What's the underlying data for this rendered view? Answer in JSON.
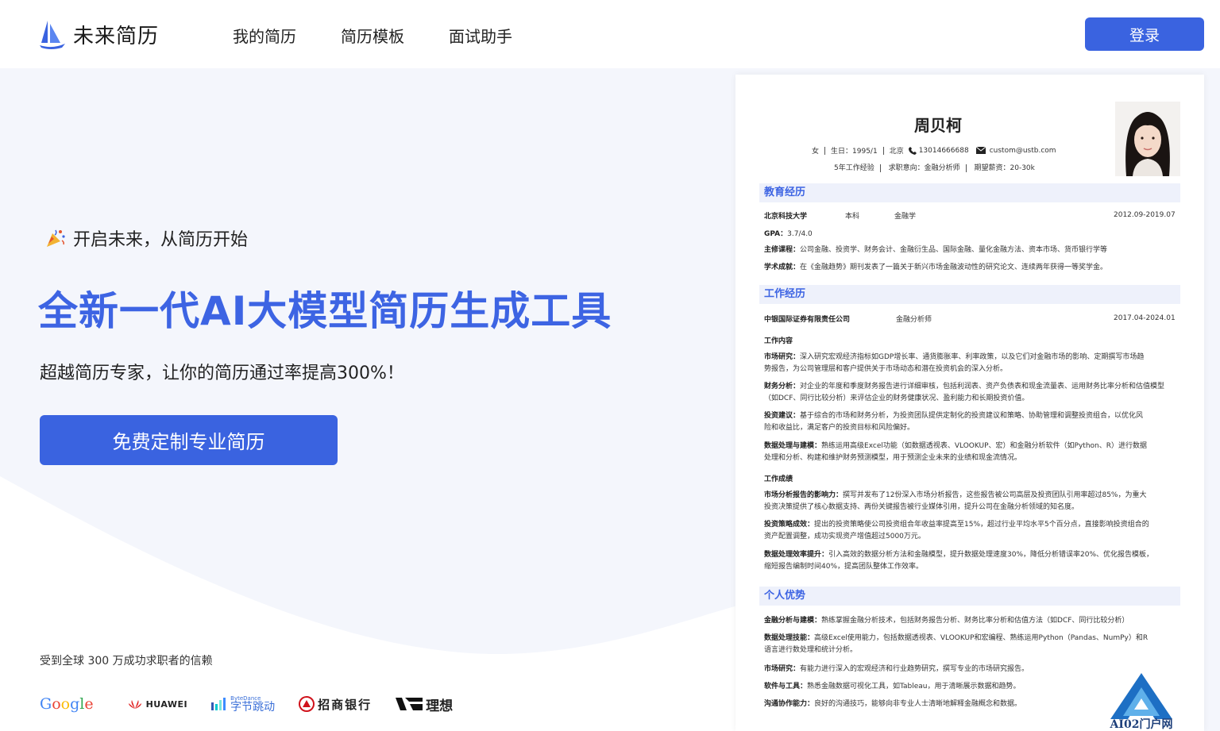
{
  "header": {
    "logo_text": "未来简历",
    "nav": [
      "我的简历",
      "简历模板",
      "面试助手"
    ],
    "login_label": "登录"
  },
  "hero": {
    "tagline": "开启未来，从简历开始",
    "headline": "全新一代AI大模型简历生成工具",
    "subhead": "超越简历专家，让你的简历通过率提高300%！",
    "cta_label": "免费定制专业简历",
    "trust_text": "受到全球 300 万成功求职者的信赖"
  },
  "partners": {
    "google": [
      "G",
      "o",
      "o",
      "g",
      "l",
      "e"
    ],
    "huawei": "HUAWEI",
    "bytedance_en": "ByteDance",
    "bytedance_cn": "字节跳动",
    "cmb": "招商银行",
    "lixiang": "理想"
  },
  "resume": {
    "name": "周贝柯",
    "gender": "女",
    "birth": "生日：1995/1",
    "city": "北京",
    "phone": "13014666688",
    "email": "custom@ustb.com",
    "experience_years": "5年工作经验",
    "target_job": "求职意向：金融分析师",
    "salary": "期望薪资：20-30k",
    "sections": {
      "education": "教育经历",
      "work": "工作经历",
      "strengths": "个人优势"
    },
    "education": {
      "school": "北京科技大学",
      "degree": "本科",
      "major": "金融学",
      "period": "2012.09-2019.07",
      "gpa_label": "GPA：",
      "gpa": "3.7/4.0",
      "courses_label": "主修课程：",
      "courses": "公司金融、投资学、财务会计、金融衍生品、国际金融、量化金融方法、资本市场、货币银行学等",
      "achievements_label": "学术成就：",
      "achievements": "在《金融趋势》期刊发表了一篇关于新兴市场金融波动性的研究论文、连续两年获得一等奖学金。"
    },
    "work": {
      "company": "中银国际证券有限责任公司",
      "title": "金融分析师",
      "period": "2017.04-2024.01",
      "content_label": "工作内容",
      "items": [
        {
          "label": "市场研究：",
          "text": "深入研究宏观经济指标如GDP增长率、通货膨胀率、利率政策，以及它们对金融市场的影响、定期撰写市场趋",
          "text2": "势报告，为公司管理层和客户提供关于市场动态和潜在投资机会的深入分析。"
        },
        {
          "label": "财务分析：",
          "text": "对企业的年度和季度财务报告进行详细审核，包括利润表、资产负债表和现金流量表、运用财务比率分析和估值模型",
          "text2": "（如DCF、同行比较分析）来评估企业的财务健康状况、盈利能力和长期投资价值。"
        },
        {
          "label": "投资建议：",
          "text": "基于综合的市场和财务分析，为投资团队提供定制化的投资建议和策略、协助管理和调整投资组合，以优化风",
          "text2": "险和收益比，满足客户的投资目标和风险偏好。"
        },
        {
          "label": "数据处理与建模：",
          "text": "熟练运用高级Excel功能（如数据透视表、VLOOKUP、宏）和金融分析软件（如Python、R）进行数据",
          "text2": "处理和分析、构建和维护财务预测模型，用于预测企业未来的业绩和现金流情况。"
        }
      ],
      "results_label": "工作成绩",
      "results": [
        {
          "label": "市场分析报告的影响力：",
          "text": "撰写并发布了12份深入市场分析报告，这些报告被公司高层及投资团队引用率超过85%，为重大",
          "text2": "投资决策提供了核心数据支持、两份关键报告被行业媒体引用，提升公司在金融分析领域的知名度。"
        },
        {
          "label": "投资策略成效：",
          "text": "提出的投资策略使公司投资组合年收益率提高至15%，超过行业平均水平5个百分点，直接影响投资组合的",
          "text2": "资产配置调整，成功实现资产增值超过5000万元。"
        },
        {
          "label": "数据处理效率提升：",
          "text": "引入高效的数据分析方法和金融模型，提升数据处理速度30%，降低分析错误率20%、优化报告模板，",
          "text2": "缩短报告编制时间40%，提高团队整体工作效率。"
        }
      ]
    },
    "strengths": [
      {
        "label": "金融分析与建模：",
        "text": "熟练掌握金融分析技术，包括财务报告分析、财务比率分析和估值方法（如DCF、同行比较分析）",
        "text2": ""
      },
      {
        "label": "数据处理技能：",
        "text": "高级Excel使用能力，包括数据透视表、VLOOKUP和宏编程、熟练运用Python（Pandas、NumPy）和R",
        "text2": "语言进行数处理和统计分析。"
      },
      {
        "label": "市场研究：",
        "text": "有能力进行深入的宏观经济和行业趋势研究，撰写专业的市场研究报告。",
        "text2": ""
      },
      {
        "label": "软件与工具：",
        "text": "熟悉金融数据可视化工具，如Tableau，用于清晰展示数据和趋势。",
        "text2": ""
      },
      {
        "label": "沟通协作能力：",
        "text": "良好的沟通技巧，能够向非专业人士清晰地解释金融概念和数据。",
        "text2": ""
      }
    ]
  },
  "watermark": "AI02门户网",
  "colors": {
    "primary": "#3a63e0",
    "headline": "#3d64e3",
    "section_bg": "#eef1fb"
  }
}
